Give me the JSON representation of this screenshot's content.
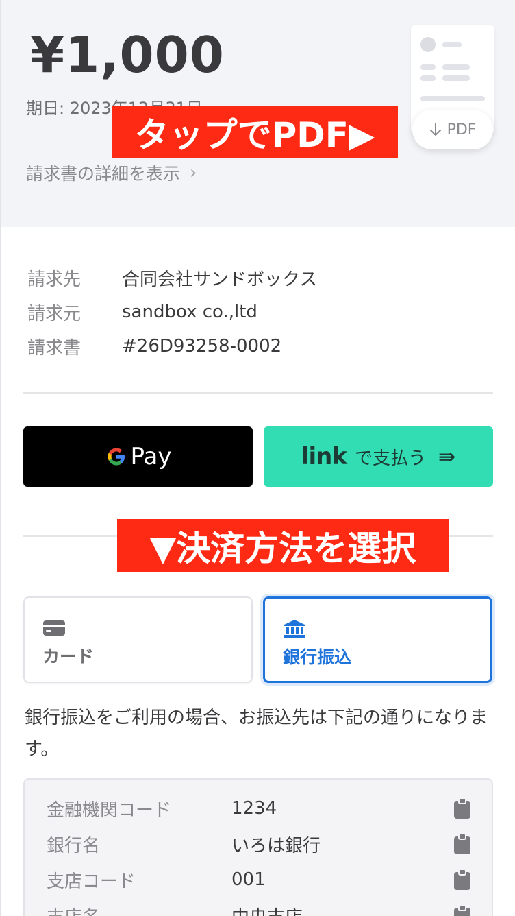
{
  "invoice": {
    "amount": "¥1,000",
    "due_date": "期日: 2023年12月31日",
    "details_link": "請求書の詳細を表示",
    "pdf_label": "PDF"
  },
  "annotations": {
    "tap_pdf": "タップでPDF▶",
    "select_method": "▼決済方法を選択"
  },
  "parties": [
    {
      "label": "請求先",
      "value": "合同会社サンドボックス"
    },
    {
      "label": "請求元",
      "value": "sandbox co.,ltd"
    },
    {
      "label": "請求書",
      "value": "#26D93258-0002"
    }
  ],
  "wallets": {
    "gpay_label": "Pay",
    "link_brand": "link",
    "link_text": "で支払う"
  },
  "methods": {
    "card_label": "カード",
    "bank_label": "銀行振込"
  },
  "bank_note": "銀行振込をご利用の場合、お振込先は下記の通りになります。",
  "bank_details": [
    {
      "label": "金融機関コード",
      "value": "1234"
    },
    {
      "label": "銀行名",
      "value": "いろは銀行"
    },
    {
      "label": "支店コード",
      "value": "001"
    },
    {
      "label": "支店名",
      "value": "中央支店"
    }
  ],
  "colors": {
    "accent": "#1f74dc",
    "link_green": "#33ddb3",
    "annotation_red": "#ff2a14"
  }
}
